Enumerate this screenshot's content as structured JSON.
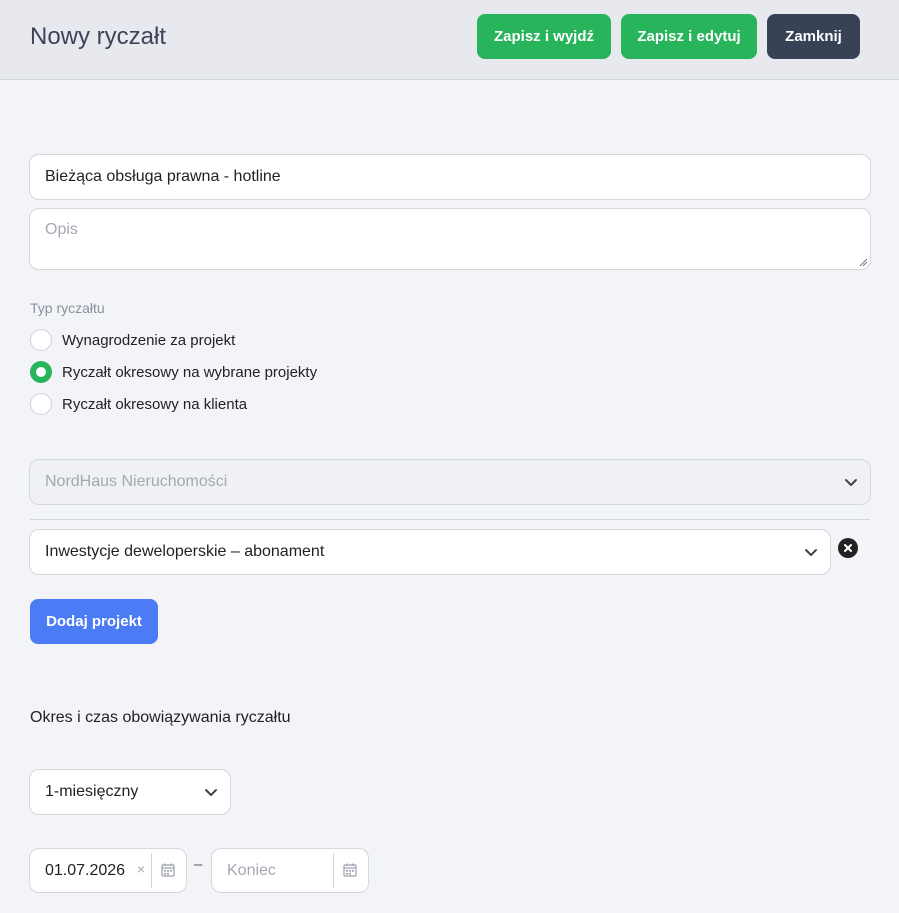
{
  "header": {
    "title": "Nowy ryczałt",
    "save_exit_label": "Zapisz i wyjdź",
    "save_edit_label": "Zapisz i edytuj",
    "close_label": "Zamknij"
  },
  "form": {
    "name_value": "Bieżąca obsługa prawna - hotline",
    "description_placeholder": "Opis",
    "type_label": "Typ ryczałtu",
    "type_options": [
      {
        "label": "Wynagrodzenie za projekt",
        "checked": false
      },
      {
        "label": "Ryczałt okresowy na wybrane projekty",
        "checked": true
      },
      {
        "label": "Ryczałt okresowy na klienta",
        "checked": false
      }
    ],
    "client_value": "NordHaus Nieruchomości",
    "project_value": "Inwestycje deweloperskie – abonament",
    "add_project_label": "Dodaj projekt",
    "period_section_title": "Okres i czas obowiązywania ryczałtu",
    "period_value": "1-miesięczny",
    "start_date_value": "01.07.2026",
    "end_date_placeholder": "Koniec",
    "date_separator": "–",
    "clear_glyph": "×"
  },
  "colors": {
    "accent_green": "#27b45a",
    "dark_button": "#374256",
    "primary_blue": "#4b7bf5"
  },
  "icons": {
    "chevron": "chevron-down-icon",
    "calendar": "calendar-icon",
    "remove": "close-circle-icon"
  }
}
